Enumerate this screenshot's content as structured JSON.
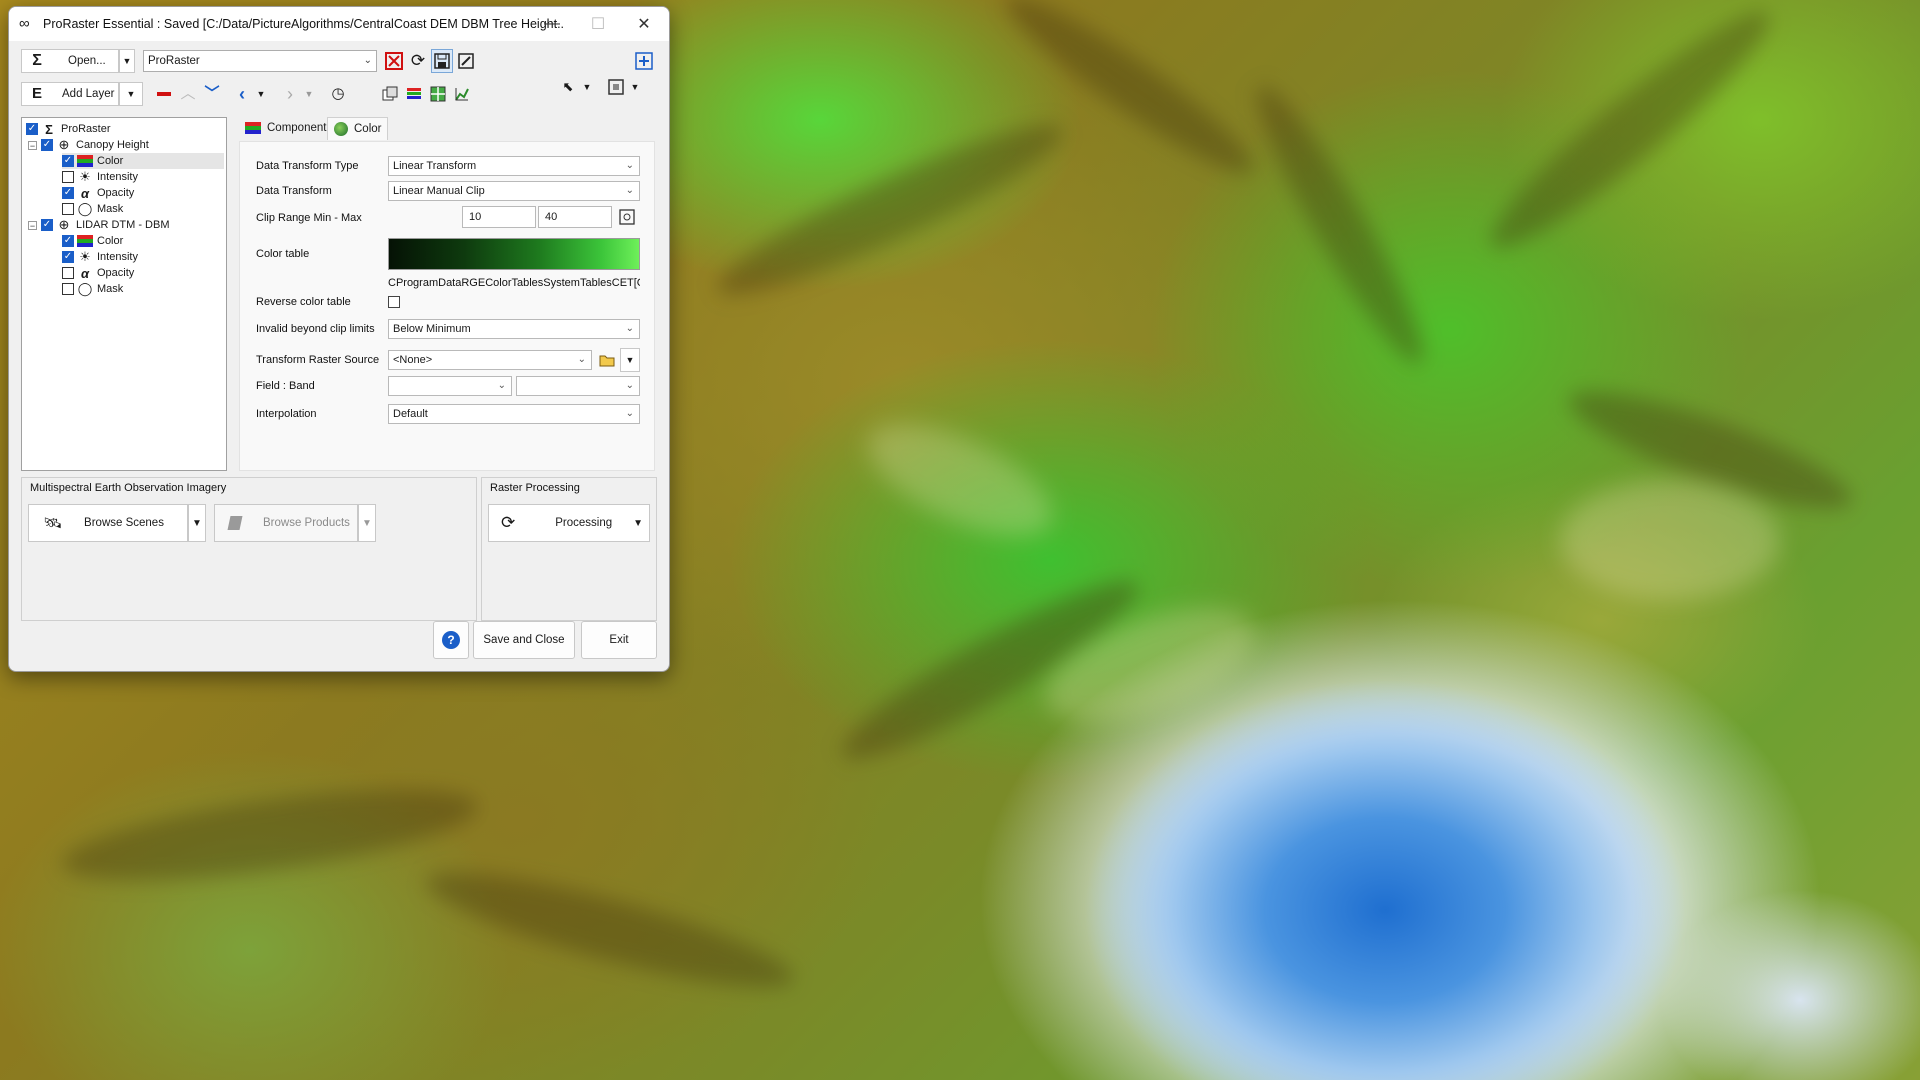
{
  "window": {
    "title": "ProRaster Essential : Saved [C:/Data/PictureAlgorithms/CentralCoast DEM DBM Tree Height...",
    "minimize_glyph": "—",
    "maximize_glyph": "☐",
    "close_glyph": "✕"
  },
  "toolbar": {
    "open_label": "Open...",
    "project_combo": "ProRaster",
    "add_layer_label": "Add Layer"
  },
  "tree": {
    "root": "ProRaster",
    "layers": [
      {
        "name": "Canopy Height",
        "children": [
          "Color",
          "Intensity",
          "Opacity",
          "Mask"
        ]
      },
      {
        "name": "LIDAR DTM - DBM",
        "children": [
          "Color",
          "Intensity",
          "Opacity",
          "Mask"
        ]
      }
    ]
  },
  "tabs": {
    "component": "Component",
    "color": "Color"
  },
  "props": {
    "data_transform_type_label": "Data Transform Type",
    "data_transform_type_value": "Linear Transform",
    "data_transform_label": "Data Transform",
    "data_transform_value": "Linear Manual Clip",
    "clip_range_label": "Clip Range Min - Max",
    "clip_min": "10",
    "clip_max": "40",
    "color_table_label": "Color table",
    "color_table_path": "CProgramDataRGEColorTablesSystemTablesCET[CET",
    "reverse_label": "Reverse color table",
    "invalid_label": "Invalid beyond clip limits",
    "invalid_value": "Below Minimum",
    "transform_source_label": "Transform Raster Source",
    "transform_source_value": "<None>",
    "field_band_label": "Field : Band",
    "interpolation_label": "Interpolation",
    "interpolation_value": "Default"
  },
  "multispectral": {
    "title": "Multispectral Earth Observation Imagery",
    "browse_scenes": "Browse Scenes",
    "browse_products": "Browse Products"
  },
  "raster_processing": {
    "title": "Raster Processing",
    "processing": "Processing"
  },
  "footer": {
    "help_glyph": "?",
    "save_close": "Save and Close",
    "exit": "Exit"
  },
  "colors": {
    "accent": "#1a5ec8",
    "color_table_start": "#0b1f0b",
    "color_table_end": "#5ee84a"
  }
}
